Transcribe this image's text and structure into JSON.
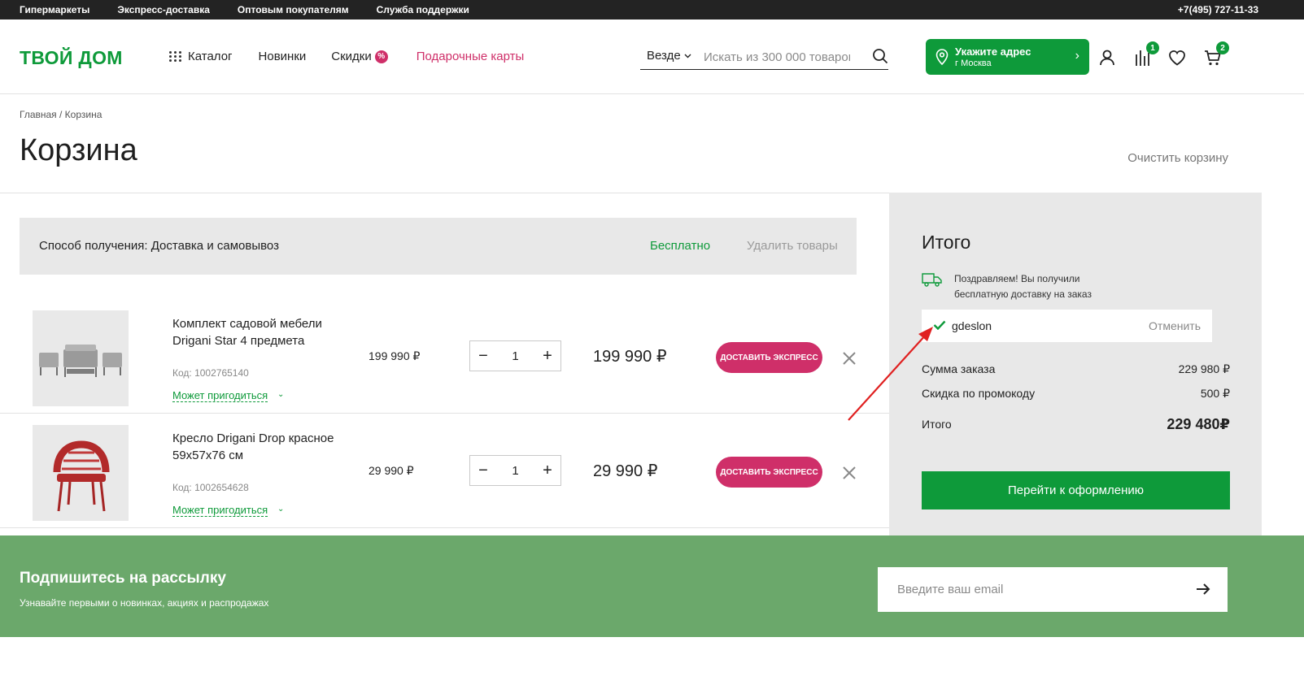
{
  "topbar": {
    "links": [
      "Гипермаркеты",
      "Экспресс-доставка",
      "Оптовым покупателям",
      "Служба поддержки"
    ],
    "phone": "+7(495) 727-11-33"
  },
  "header": {
    "logo": "ТВОЙ ДОМ",
    "nav": {
      "catalog": "Каталог",
      "new": "Новинки",
      "sale": "Скидки",
      "sale_badge": "%",
      "gift_cards": "Подарочные карты"
    },
    "search": {
      "scope": "Везде",
      "placeholder": "Искать из 300 000 товаров"
    },
    "address": {
      "title": "Укажите адрес",
      "city": "г Москва"
    },
    "compare_count": "1",
    "cart_count": "2"
  },
  "breadcrumb": "Главная / Корзина",
  "page_title": "Корзина",
  "clear_cart": "Очистить корзину",
  "delivery": {
    "label": "Способ получения: Доставка и самовывоз",
    "price": "Бесплатно",
    "remove": "Удалить товары"
  },
  "items": [
    {
      "name": "Комплект садовой мебели Drigani Star 4 предмета",
      "code": "Код: 1002765140",
      "useful": "Может пригодиться",
      "unit_price": "199 990 ₽",
      "qty": "1",
      "total": "199 990 ₽",
      "express": "ДОСТАВИТЬ ЭКСПРЕСС"
    },
    {
      "name": "Кресло Drigani Drop красное 59х57х76 см",
      "code": "Код: 1002654628",
      "useful": "Может пригодиться",
      "unit_price": "29 990 ₽",
      "qty": "1",
      "total": "29 990 ₽",
      "express": "ДОСТАВИТЬ ЭКСПРЕСС"
    }
  ],
  "summary": {
    "title": "Итого",
    "congrats": "Поздравляем! Вы получили бесплатную доставку на заказ",
    "promo_code": "gdeslon",
    "promo_cancel": "Отменить",
    "order_sum_label": "Сумма заказа",
    "order_sum": "229 980 ₽",
    "discount_label": "Скидка по промокоду",
    "discount": "500 ₽",
    "grand_label": "Итого",
    "grand": "229 480₽",
    "checkout": "Перейти к оформлению"
  },
  "newsletter": {
    "title": "Подпишитесь на рассылку",
    "subtitle": "Узнавайте первыми о новинках, акциях и распродажах",
    "placeholder": "Введите ваш email"
  },
  "colors": {
    "brand_green": "#0e9a3a",
    "accent_pink": "#cf2f69",
    "newsletter_green": "#6ba86b",
    "annotation_red": "#e02020"
  }
}
